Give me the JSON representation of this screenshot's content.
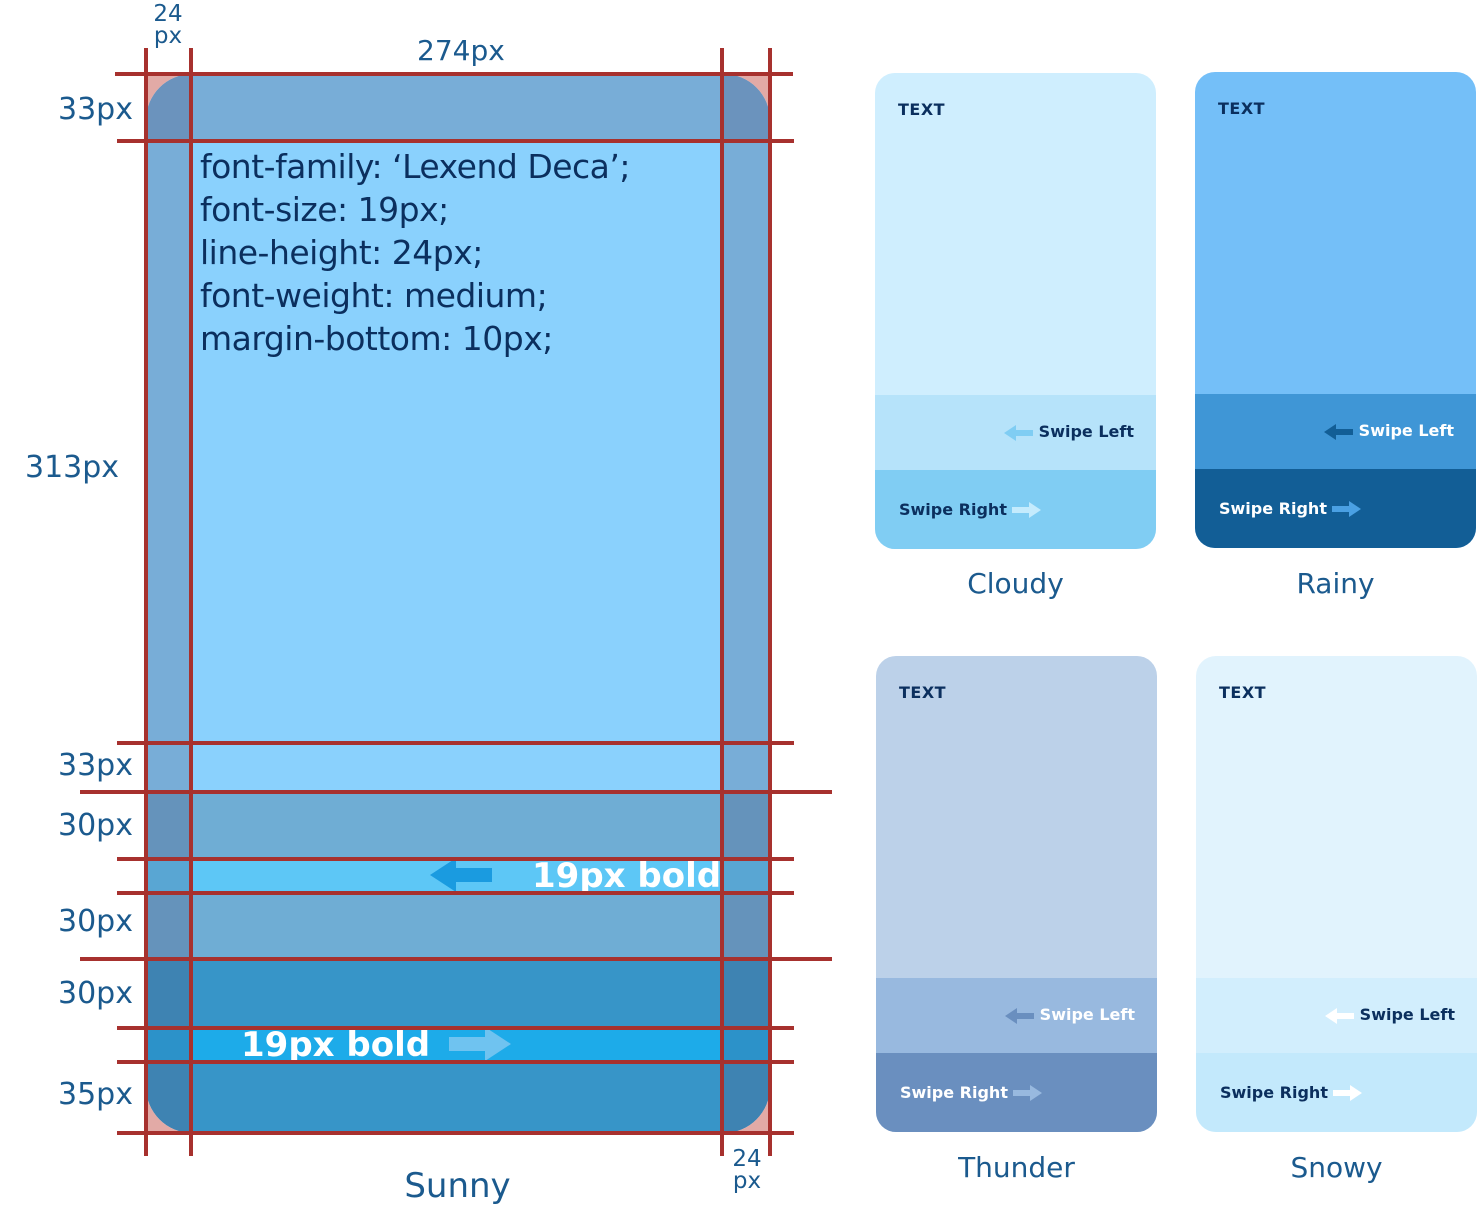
{
  "spec": {
    "lines": [
      "font-family: ‘Lexend Deca’;",
      "font-size: 19px;",
      "line-height: 24px;",
      "font-weight: medium;",
      "margin-bottom: 10px;"
    ],
    "dims": {
      "top_24": [
        "24",
        "px"
      ],
      "width_274": "274px",
      "top_33": "33px",
      "body_313": "313px",
      "gap_33": "33px",
      "sl_30a": "30px",
      "sl_30b": "30px",
      "sr_30": "30px",
      "sr_35": "35px",
      "bottom_24": [
        "24",
        "px"
      ]
    },
    "swipe_left_label": "19px bold",
    "swipe_right_label": "19px bold",
    "caption": "Sunny",
    "colors": {
      "body": "#8ad1fd",
      "swipe_left": "#6fadd4",
      "swipe_left_strip": "#5dc7f6",
      "swipe_right": "#3795c8",
      "swipe_right_strip": "#1dabe9",
      "guide": "#a7312e"
    }
  },
  "cards": [
    {
      "caption": "Cloudy",
      "text": "TEXT",
      "swipe_left": "Swipe Left",
      "swipe_right": "Swipe Right",
      "colors": {
        "body": "#cfeefe",
        "sl": "#b6e3fa",
        "sr": "#80cdf3",
        "text": "#0b2f5e",
        "sl_text": "#0b2f5e",
        "sr_text": "#0b2f5e",
        "sl_icon": "#7fcdf3",
        "sr_icon": "#c4ebfd"
      }
    },
    {
      "caption": "Rainy",
      "text": "TEXT",
      "swipe_left": "Swipe Left",
      "swipe_right": "Swipe Right",
      "colors": {
        "body": "#74bff8",
        "sl": "#3f96d6",
        "sr": "#125e96",
        "text": "#0b2f5e",
        "sl_text": "#ffffff",
        "sr_text": "#ffffff",
        "sl_icon": "#125e96",
        "sr_icon": "#4aa0e3"
      }
    },
    {
      "caption": "Thunder",
      "text": "TEXT",
      "swipe_left": "Swipe Left",
      "swipe_right": "Swipe Right",
      "colors": {
        "body": "#bcd1e9",
        "sl": "#98b9df",
        "sr": "#6a8fbf",
        "text": "#0b2f5e",
        "sl_text": "#ffffff",
        "sr_text": "#ffffff",
        "sl_icon": "#6a8fbf",
        "sr_icon": "#98b9df"
      }
    },
    {
      "caption": "Snowy",
      "text": "TEXT",
      "swipe_left": "Swipe Left",
      "swipe_right": "Swipe Right",
      "colors": {
        "body": "#e1f3fd",
        "sl": "#d2eefd",
        "sr": "#c3e9fc",
        "text": "#0b2f5e",
        "sl_text": "#0b2f5e",
        "sr_text": "#0b2f5e",
        "sl_icon": "#ffffff",
        "sr_icon": "#ffffff"
      }
    }
  ]
}
